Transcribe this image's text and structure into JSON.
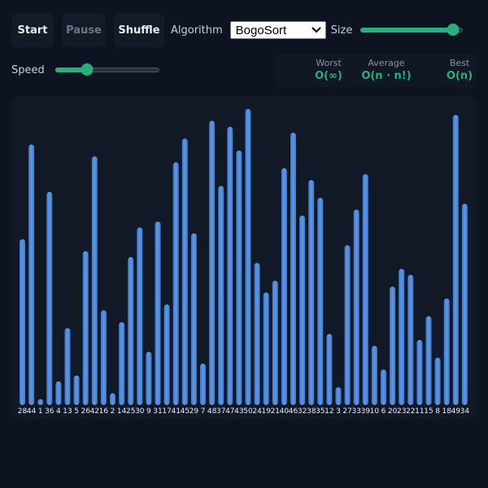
{
  "toolbar": {
    "start_label": "Start",
    "pause_label": "Pause",
    "shuffle_label": "Shuffle",
    "algorithm_label": "Algorithm",
    "algorithm_selected": "BogoSort",
    "size_label": "Size",
    "size_level": 0.95
  },
  "speed": {
    "label": "Speed",
    "level": 0.28
  },
  "complexity": {
    "worst_label": "Worst",
    "worst_value": "O(∞)",
    "average_label": "Average",
    "average_value": "O(n · n!)",
    "best_label": "Best",
    "best_value": "O(n)"
  },
  "colors": {
    "accent": "#27b07e",
    "bar": "#4a86dc"
  },
  "chart_data": {
    "type": "bar",
    "values": [
      28,
      44,
      1,
      36,
      4,
      13,
      5,
      26,
      42,
      16,
      2,
      14,
      25,
      30,
      9,
      31,
      17,
      41,
      45,
      29,
      7,
      48,
      37,
      47,
      43,
      50,
      24,
      19,
      21,
      40,
      46,
      32,
      38,
      35,
      12,
      3,
      27,
      33,
      39,
      10,
      6,
      20,
      23,
      22,
      11,
      15,
      8,
      18,
      49,
      34
    ],
    "ylim": [
      0,
      50
    ]
  }
}
